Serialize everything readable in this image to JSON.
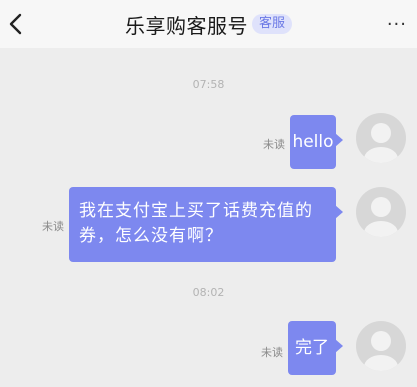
{
  "header": {
    "title": "乐享购客服号",
    "badge": "客服",
    "more": "···"
  },
  "messages": [
    {
      "timestamp": "07:58"
    },
    {
      "status": "未读",
      "text": "hello"
    },
    {
      "status": "未读",
      "text": "我在支付宝上买了话费充值的券，怎么没有啊？"
    },
    {
      "timestamp": "08:02"
    },
    {
      "status": "未读",
      "text": "完了"
    }
  ],
  "colors": {
    "bubble": "#7d88ef",
    "badge_text": "#6b79e6",
    "badge_bg": "#dfe2fb",
    "background": "#ededed"
  },
  "icons": [
    "back-arrow-icon",
    "more-icon",
    "avatar-icon"
  ]
}
